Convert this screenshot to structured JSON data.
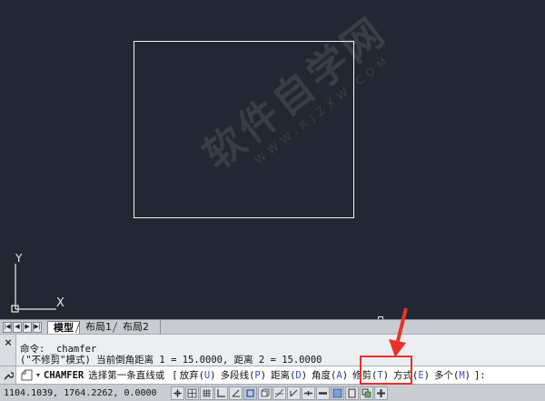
{
  "viewport": {
    "ucs": {
      "y_label": "Y",
      "x_label": "X"
    }
  },
  "watermark": {
    "main": "软件自学网",
    "sub": "WWW.RJZXW.COM"
  },
  "layout_tabs": {
    "nav_buttons": [
      "|◀",
      "◀",
      "▶",
      "▶|"
    ],
    "tabs": [
      {
        "label": "模型",
        "active": true
      },
      {
        "label": "布局1",
        "active": false
      },
      {
        "label": "布局2",
        "active": false
      }
    ]
  },
  "command_history": {
    "line1": "命令: _chamfer",
    "line2": "(\"不修剪\"模式) 当前倒角距离 1 = 15.0000, 距离 2 = 15.0000"
  },
  "command_line": {
    "command": "CHAMFER",
    "prompt": "选择第一条直线或",
    "bracket_open": "[",
    "options": [
      {
        "label": "放弃",
        "key": "U"
      },
      {
        "label": "多段线",
        "key": "P"
      },
      {
        "label": "距离",
        "key": "D"
      },
      {
        "label": "角度",
        "key": "A"
      },
      {
        "label": "修剪",
        "key": "T"
      },
      {
        "label": "方式",
        "key": "E"
      },
      {
        "label": "多个",
        "key": "M"
      }
    ],
    "bracket_close": "]:"
  },
  "status_bar": {
    "coordinates": "1104.1039, 1764.2262, 0.0000"
  },
  "colors": {
    "canvas": "#222833",
    "geometry": "#f2f2f2",
    "highlight": "#e8322a",
    "option_key": "#2f55c4"
  }
}
